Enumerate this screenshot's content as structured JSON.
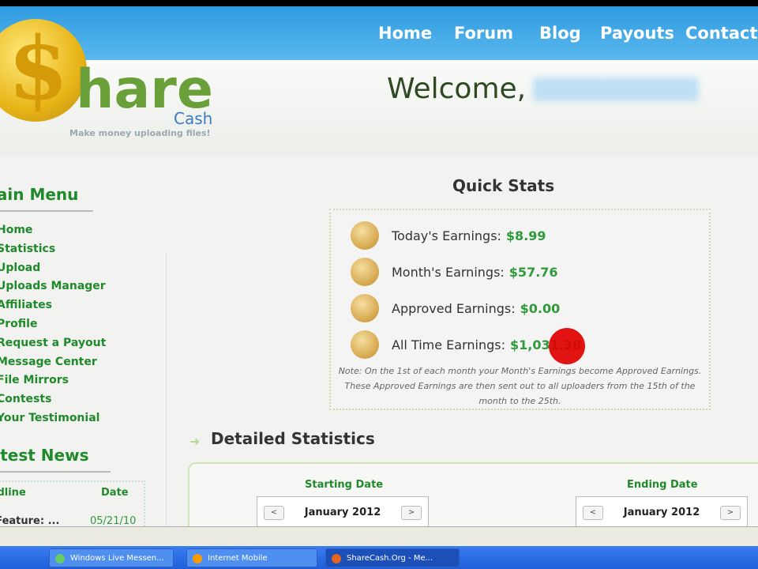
{
  "nav": {
    "items": [
      "Home",
      "Forum",
      "Blog",
      "Payouts",
      "Contact"
    ]
  },
  "logo": {
    "dollar": "$",
    "text": "hare",
    "sub": "Cash",
    "tagline": "Make money uploading files!"
  },
  "welcome": "Welcome,",
  "sidebar": {
    "menu_title": "Main Menu",
    "items": [
      "Home",
      "Statistics",
      "Upload",
      "Uploads Manager",
      "Affiliates",
      "Profile",
      "Request a Payout",
      "Message Center",
      "File Mirrors",
      "Contests",
      "Your Testimonial"
    ],
    "news_title": "Latest News",
    "news_headers": [
      "Headline",
      "Date"
    ],
    "news_rows": [
      {
        "headline": "New Feature: ...",
        "date": "05/21/10"
      }
    ]
  },
  "quick_stats": {
    "title": "Quick Stats",
    "rows": [
      {
        "label": "Today's Earnings:",
        "value": "$8.99"
      },
      {
        "label": "Month's Earnings:",
        "value": "$57.76"
      },
      {
        "label": "Approved Earnings:",
        "value": "$0.00"
      },
      {
        "label": "All Time Earnings:",
        "value": "$1,031.38"
      }
    ],
    "note": "Note: On the 1st of each month your Month's Earnings become Approved Earnings. These Approved Earnings are then sent out to all uploaders from the 15th of the month to the 25th."
  },
  "detailed": {
    "title": "Detailed Statistics",
    "start_label": "Starting Date",
    "start_value": "January 2012",
    "end_label": "Ending Date",
    "end_value": "January 2012",
    "prev": "<",
    "next": ">"
  },
  "taskbar": {
    "items": [
      "Windows Live Messen...",
      "Internet Mobile",
      "ShareCash.Org - Me..."
    ]
  }
}
